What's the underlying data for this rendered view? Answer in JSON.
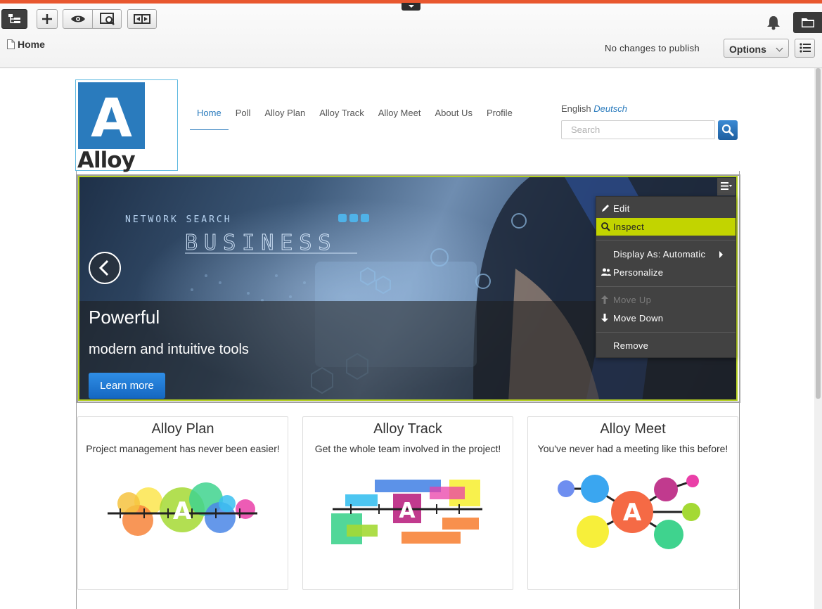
{
  "toolbar": {
    "breadcrumb": "Home",
    "publish_status": "No changes to publish",
    "options_label": "Options"
  },
  "site": {
    "logo_letter": "A",
    "logo_text": "Alloy",
    "nav": [
      "Home",
      "Poll",
      "Alloy Plan",
      "Alloy Track",
      "Alloy Meet",
      "About Us",
      "Profile"
    ],
    "lang_current": "English",
    "lang_alt": "Deutsch",
    "search_placeholder": "Search"
  },
  "hero": {
    "title": "Powerful",
    "subtitle": "modern and intuitive tools",
    "button": "Learn more",
    "bg_network": "NETWORK SEARCH",
    "bg_business": "BUSINESS"
  },
  "context_menu": {
    "edit": "Edit",
    "inspect": "Inspect",
    "display_as": "Display As: Automatic",
    "personalize": "Personalize",
    "move_up": "Move Up",
    "move_down": "Move Down",
    "remove": "Remove"
  },
  "cards": [
    {
      "title": "Alloy Plan",
      "desc": "Project management has never been easier!"
    },
    {
      "title": "Alloy Track",
      "desc": "Get the whole team involved in the project!"
    },
    {
      "title": "Alloy Meet",
      "desc": "You've never had a meeting like this before!"
    }
  ],
  "colors": {
    "accent": "#e8572f",
    "brand_blue": "#2a7bbd",
    "highlight": "#c2d400"
  }
}
